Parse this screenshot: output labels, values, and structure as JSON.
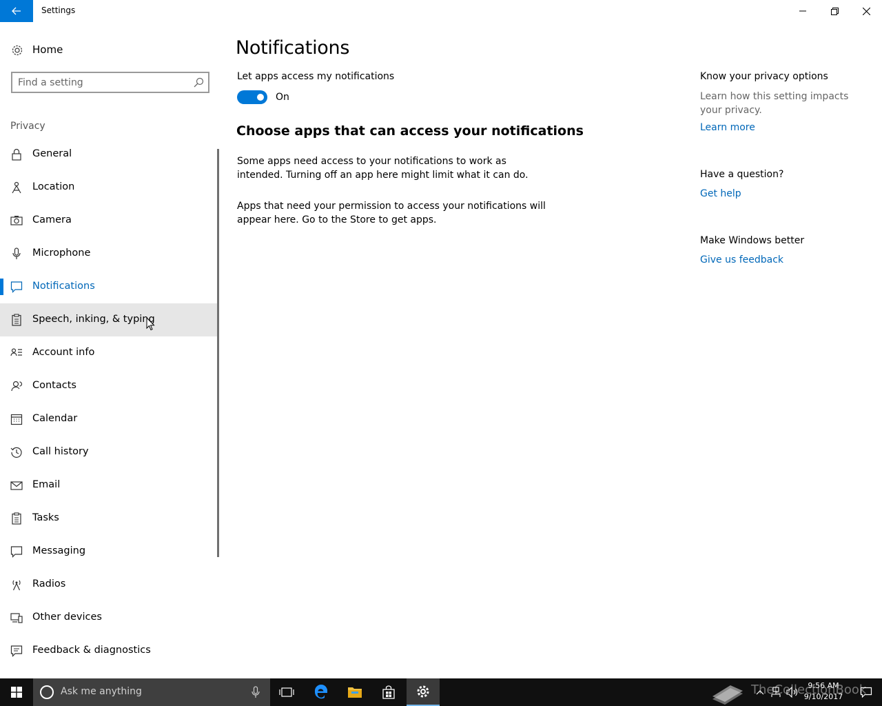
{
  "window": {
    "title": "Settings",
    "back_icon": "back-arrow-icon",
    "minimize_icon": "minimize-icon",
    "maximize_icon": "restore-icon",
    "close_icon": "close-icon"
  },
  "sidebar": {
    "home_label": "Home",
    "search_placeholder": "Find a setting",
    "section_label": "Privacy",
    "items": [
      {
        "label": "General",
        "icon": "lock-icon"
      },
      {
        "label": "Location",
        "icon": "location-icon"
      },
      {
        "label": "Camera",
        "icon": "camera-icon"
      },
      {
        "label": "Microphone",
        "icon": "microphone-icon"
      },
      {
        "label": "Notifications",
        "icon": "notification-icon",
        "active": true
      },
      {
        "label": "Speech, inking, & typing",
        "icon": "clipboard-icon",
        "hover": true
      },
      {
        "label": "Account info",
        "icon": "account-info-icon"
      },
      {
        "label": "Contacts",
        "icon": "contacts-icon"
      },
      {
        "label": "Calendar",
        "icon": "calendar-icon"
      },
      {
        "label": "Call history",
        "icon": "history-icon"
      },
      {
        "label": "Email",
        "icon": "email-icon"
      },
      {
        "label": "Tasks",
        "icon": "tasks-icon"
      },
      {
        "label": "Messaging",
        "icon": "messaging-icon"
      },
      {
        "label": "Radios",
        "icon": "radios-icon"
      },
      {
        "label": "Other devices",
        "icon": "devices-icon"
      },
      {
        "label": "Feedback & diagnostics",
        "icon": "feedback-icon"
      }
    ]
  },
  "main": {
    "title": "Notifications",
    "toggle_label": "Let apps access my notifications",
    "toggle_state": "On",
    "subheading": "Choose apps that can access your notifications",
    "para1": "Some apps need access to your notifications to work as intended. Turning off an app here might limit what it can do.",
    "para2": "Apps that need your permission to access your notifications will appear here. Go to the Store to get apps."
  },
  "right": {
    "privacy_heading": "Know your privacy options",
    "privacy_text": "Learn how this setting impacts your privacy.",
    "learn_more": "Learn more",
    "question_heading": "Have a question?",
    "get_help": "Get help",
    "better_heading": "Make Windows better",
    "feedback_link": "Give us feedback"
  },
  "taskbar": {
    "search_placeholder": "Ask me anything",
    "time": "9:56 AM",
    "date": "9/10/2017",
    "watermark": "TheCollectionBook",
    "accent": "#0078d7"
  }
}
